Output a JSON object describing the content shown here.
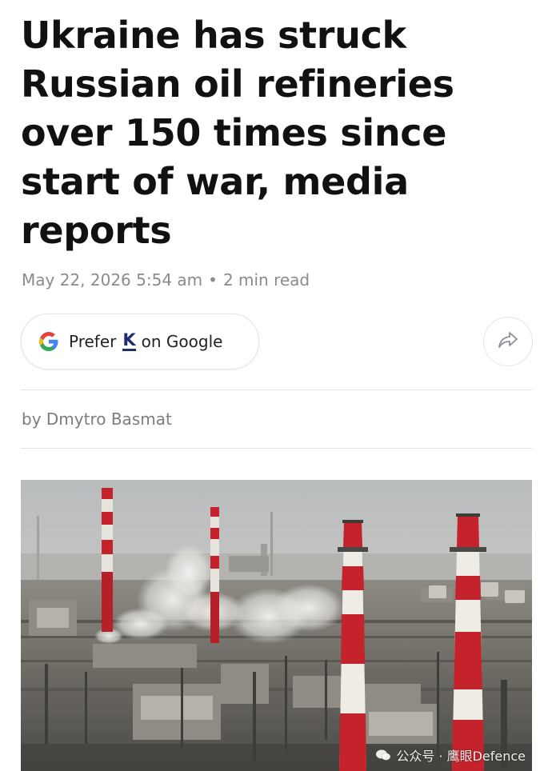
{
  "article": {
    "headline": "Ukraine has struck Russian oil refineries over 150 times since start of war, media reports",
    "date": "May 22, 2026 5:54 am",
    "separator": "•",
    "read_time": "2 min read",
    "byline": "by Dmytro Basmat"
  },
  "prefer_button": {
    "prefix": "Prefer",
    "brand_logo_letter": "K",
    "suffix": "on Google"
  },
  "icons": {
    "google": "google-g-icon",
    "share": "share-arrow-icon",
    "watermark": "wechat-icon"
  },
  "image": {
    "description_alt": "",
    "watermark_text": "公众号 · 鹰眼Defence"
  },
  "colors": {
    "headline": "#111111",
    "meta": "#8b8b8b",
    "brand_logo": "#1f2f6b",
    "chimney_red": "#c4232b"
  }
}
